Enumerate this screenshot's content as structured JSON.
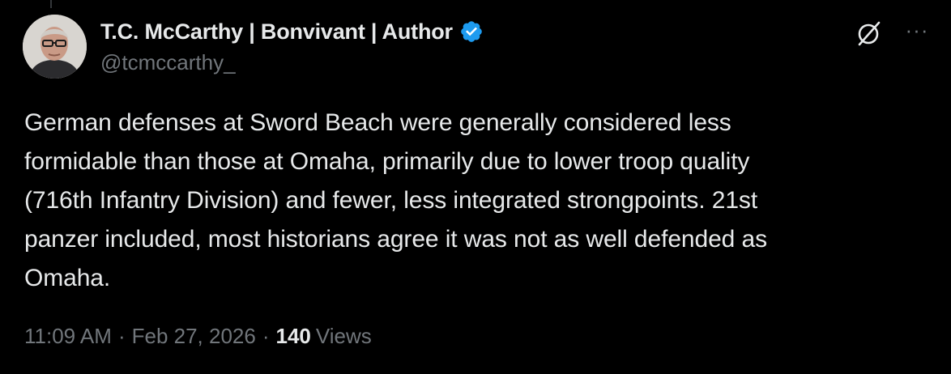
{
  "author": {
    "display_name": "T.C. McCarthy | Bonvivant | Author",
    "handle": "@tcmccarthy_",
    "verified": true
  },
  "tweet": {
    "text": "German defenses at Sword Beach were generally considered less\nformidable than those at Omaha, primarily due to lower troop quality\n(716th Infantry Division) and fewer, less integrated strongpoints. 21st\npanzer included, most historians agree it was not as well defended as\nOmaha."
  },
  "meta": {
    "time": "11:09 AM",
    "separator": "·",
    "date": "Feb 27, 2026",
    "views_count": "140",
    "views_label": "Views"
  },
  "icons": {
    "verified": "verified-badge-icon",
    "grok": "grok-icon",
    "more": "more-options-icon"
  },
  "colors": {
    "background": "#000000",
    "text_primary": "#e7e9ea",
    "text_secondary": "#71767b",
    "verified_blue": "#1d9bf0"
  }
}
